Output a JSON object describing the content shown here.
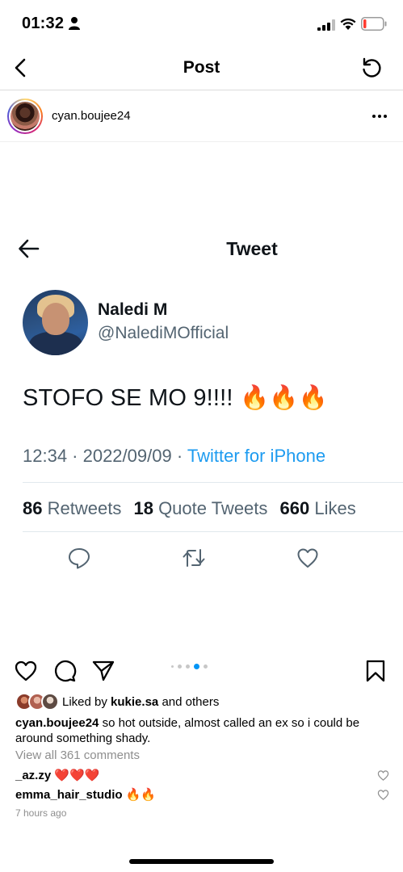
{
  "status_bar": {
    "time": "01:32"
  },
  "header": {
    "title": "Post"
  },
  "post": {
    "author": "cyan.boujee24",
    "liked_by_prefix": "Liked by",
    "liked_by_user": "kukie.sa",
    "liked_by_suffix": "and others",
    "caption_user": "cyan.boujee24",
    "caption_text": "so hot outside, almost called an ex so i could be around something shady.",
    "view_comments": "View all 361 comments",
    "comments": [
      {
        "user": "_az.zy",
        "text": "❤️❤️❤️"
      },
      {
        "user": "emma_hair_studio",
        "text": "🔥🔥"
      }
    ],
    "time_ago": "7 hours ago",
    "carousel": {
      "count": 5,
      "active": 4
    }
  },
  "tweet": {
    "heading": "Tweet",
    "name": "Naledi M",
    "handle": "@NalediMOfficial",
    "text": "STOFO SE MO 9!!!! 🔥🔥🔥",
    "time": "12:34 · 2022/09/09 ·",
    "source": "Twitter for iPhone",
    "retweets_count": "86",
    "retweets_label": "Retweets",
    "quotes_count": "18",
    "quotes_label": "Quote Tweets",
    "likes_count": "660",
    "likes_label": "Likes"
  },
  "colors": {
    "twitter_blue": "#1d9bf0",
    "twitter_gray": "#536471",
    "instagram_blue": "#0095f6",
    "battery_low": "#ff3b30",
    "heart_red": "#ed4956"
  }
}
